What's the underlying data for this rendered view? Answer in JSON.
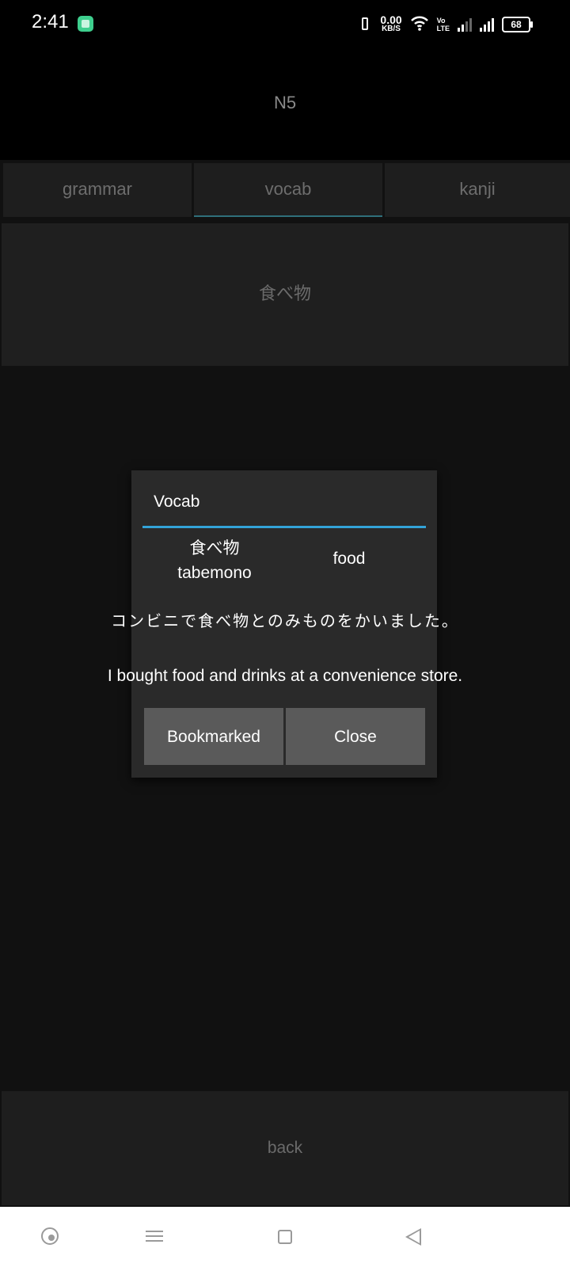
{
  "status_bar": {
    "time": "2:41",
    "net_speed_value": "0.00",
    "net_speed_unit": "KB/S",
    "volte_top": "Vo",
    "volte_bottom": "LTE",
    "battery": "68",
    "icons": [
      "app-notification-icon",
      "vibrate-icon",
      "wifi-icon",
      "volte-icon",
      "signal-icon",
      "battery-icon"
    ]
  },
  "header": {
    "title": "N5"
  },
  "tabs": [
    {
      "label": "grammar",
      "active": false
    },
    {
      "label": "vocab",
      "active": true
    },
    {
      "label": "kanji",
      "active": false
    }
  ],
  "category": {
    "label": "食べ物"
  },
  "dialog": {
    "title": "Vocab",
    "kanji": "食べ物",
    "romaji": "tabemono",
    "meaning": "food",
    "example_jp": "コンビニで食べ物とのみものをかいました。",
    "example_en": "I bought food and drinks at a convenience store.",
    "bookmark_label": "Bookmarked",
    "close_label": "Close"
  },
  "footer": {
    "back_label": "back"
  },
  "colors": {
    "accent": "#33a3d8",
    "background": "#111111",
    "dialog_bg": "#2a2a2a",
    "button_bg": "#5a5a5a"
  }
}
